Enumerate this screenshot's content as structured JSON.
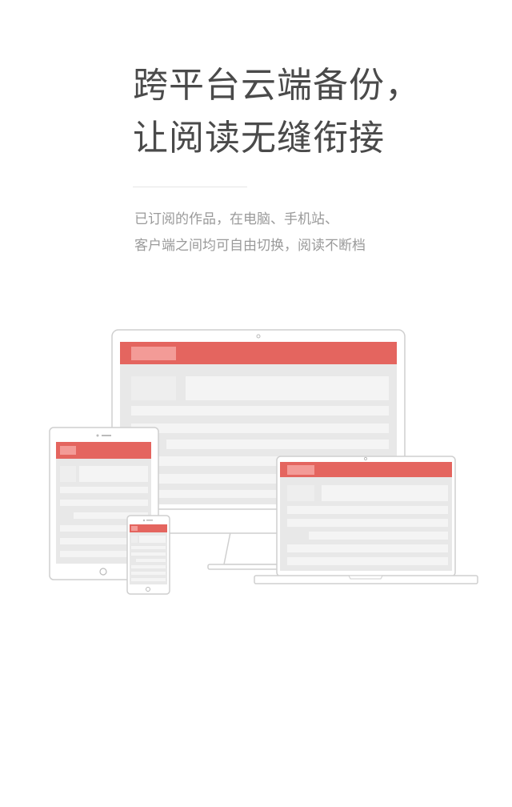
{
  "headline": {
    "line1": "跨平台云端备份，",
    "line2": "让阅读无缝衔接"
  },
  "subtitle": {
    "line1": "已订阅的作品，在电脑、手机站、",
    "line2": "客户端之间均可自由切换，阅读不断档"
  },
  "colors": {
    "accent": "#e4655f",
    "accent_light": "#f39b97",
    "screen_bg": "#e8e8e8",
    "placeholder": "#f4f4f4",
    "device_frame": "#cfcfcf",
    "text_headline": "#4a4a4a",
    "text_subtitle": "#9a9a9a"
  }
}
